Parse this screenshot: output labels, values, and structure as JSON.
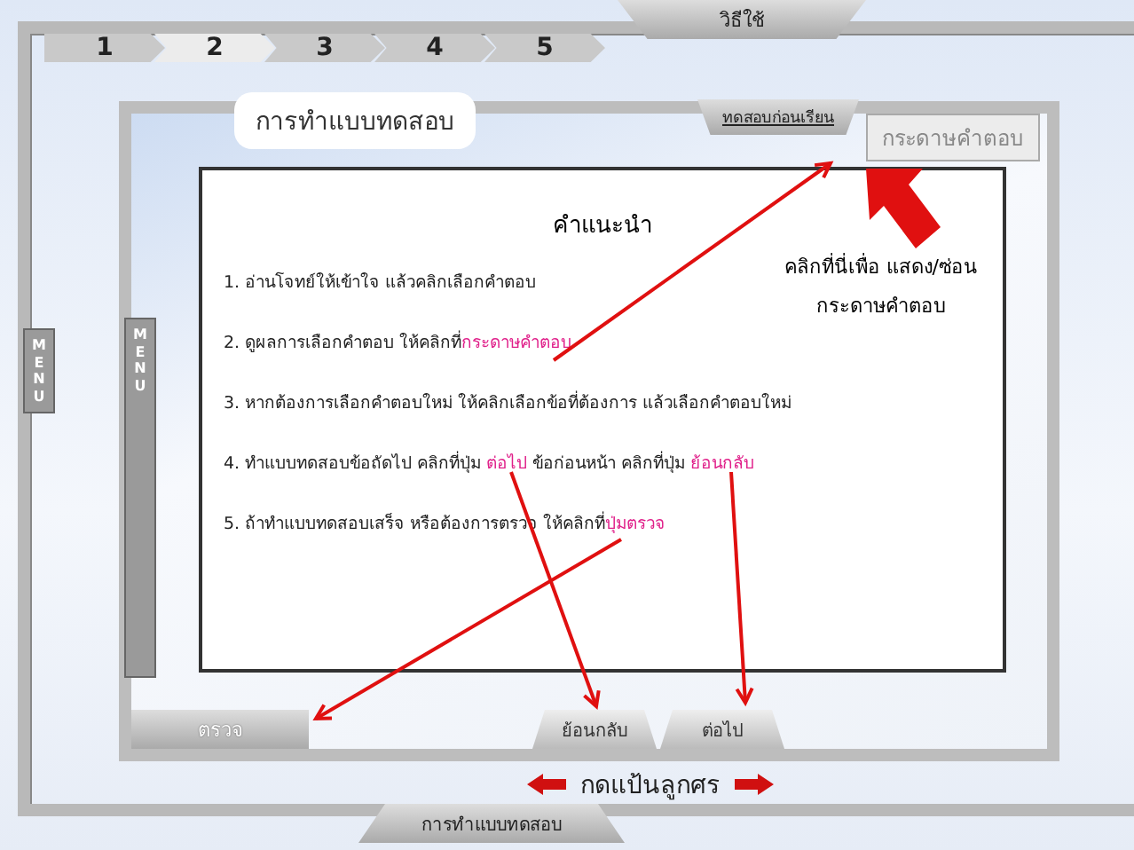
{
  "step_tabs": [
    {
      "label": "1",
      "selected": false
    },
    {
      "label": "2",
      "selected": true
    },
    {
      "label": "3",
      "selected": false
    },
    {
      "label": "4",
      "selected": false
    },
    {
      "label": "5",
      "selected": false
    }
  ],
  "help_tab": "วิธีใช้",
  "menu_tabs": [
    "MENU",
    "MENU"
  ],
  "section_label": "การทำแบบทดสอบ",
  "pretest_tab": "ทดสอบก่อนเรียน",
  "answer_sheet_button": "กระดาษคำตอบ",
  "instructions": {
    "title": "คำแนะนำ",
    "items": [
      {
        "parts": [
          {
            "text": "1. อ่านโจทย์ให้เข้าใจ แล้วคลิกเลือกคำตอบ",
            "highlight": false
          }
        ]
      },
      {
        "parts": [
          {
            "text": "2. ดูผลการเลือกคำตอบ  ให้คลิกที่",
            "highlight": false
          },
          {
            "text": "กระดาษคำตอบ",
            "highlight": true
          }
        ]
      },
      {
        "parts": [
          {
            "text": "3. หากต้องการเลือกคำตอบใหม่  ให้คลิกเลือกข้อที่ต้องการ แล้วเลือกคำตอบใหม่",
            "highlight": false
          }
        ]
      },
      {
        "parts": [
          {
            "text": "4. ทำแบบทดสอบข้อถัดไป คลิกที่ปุ่ม ",
            "highlight": false
          },
          {
            "text": "ต่อไป",
            "highlight": true
          },
          {
            "text": "  ข้อก่อนหน้า คลิกที่ปุ่ม ",
            "highlight": false
          },
          {
            "text": "ย้อนกลับ",
            "highlight": true
          }
        ]
      },
      {
        "parts": [
          {
            "text": "5. ถ้าทำแบบทดสอบเสร็จ หรือต้องการตรวจ  ให้คลิกที่",
            "highlight": false
          },
          {
            "text": "ปุ่มตรวจ",
            "highlight": true
          }
        ]
      }
    ]
  },
  "hint": [
    "คลิกที่นี่เพื่อ แสดง/ซ่อน",
    "กระดาษคำตอบ"
  ],
  "check_button": "ตรวจ",
  "back_button": "ย้อนกลับ",
  "next_button": "ต่อไป",
  "arrow_keys_hint": "กดแป้นลูกศร",
  "bottom_tab": "การทำแบบทดสอบ"
}
